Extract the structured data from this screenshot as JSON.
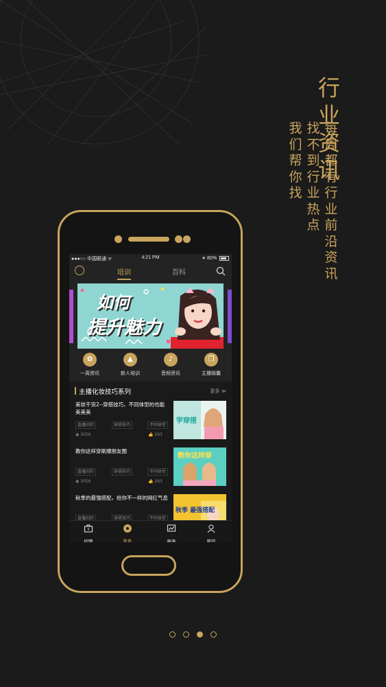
{
  "promo": {
    "headline": "行业资讯",
    "sub_col_1": "每周都有行业前沿资讯",
    "sub_col_2": "找不到行业热点",
    "sub_col_3": "我们帮你找"
  },
  "status_bar": {
    "carrier": "●●●○○ 中国联通 ᯤ",
    "time": "4:21 PM",
    "battery": "∗ 80%"
  },
  "nav": {
    "tab_active": "培训",
    "tab_inactive": "百科"
  },
  "banner": {
    "line1": "如何",
    "line2": "提升魅力"
  },
  "quick_links": [
    {
      "label": "一周资讯",
      "icon": "grid-icon",
      "glyph": "✿"
    },
    {
      "label": "新人培训",
      "icon": "hat-icon",
      "glyph": "▲"
    },
    {
      "label": "音频资讯",
      "icon": "music-icon",
      "glyph": "♪"
    },
    {
      "label": "主播锦囊",
      "icon": "book-icon",
      "glyph": "❐"
    }
  ],
  "section": {
    "title": "主播化妆技巧系列",
    "more": "更多 ≫"
  },
  "articles": [
    {
      "title": "美妆干货2--穿搭技巧，不同体型的也能美美美",
      "tags": [
        "直播间的",
        "穿搭技巧",
        "不同体型"
      ],
      "views": "3056",
      "likes": "263",
      "thumb_text": "学穿搭",
      "thumb_color": "#2fb8a8"
    },
    {
      "title": "教你这样穿刷爆朋友圈",
      "tags": [
        "直播间的",
        "穿搭技巧",
        "不同体型"
      ],
      "views": "3056",
      "likes": "263",
      "thumb_text": "教你这样穿",
      "thumb_color": "#4fc7bd"
    },
    {
      "title": "秋季的最强搭配，给你不一样的网红气息",
      "tags": [
        "直播间的",
        "穿搭技巧",
        "不同体型"
      ],
      "views": "",
      "likes": "",
      "thumb_text": "秋季 最强搭配",
      "thumb_color": "#f4c430"
    }
  ],
  "bottom_nav": [
    {
      "label": "招聘",
      "icon": "briefcase-icon"
    },
    {
      "label": "看看",
      "icon": "eye-icon"
    },
    {
      "label": "报表",
      "icon": "chart-icon"
    },
    {
      "label": "我的",
      "icon": "user-icon"
    }
  ],
  "colors": {
    "accent": "#c9a45c",
    "background": "#1b1b1b"
  },
  "pager": {
    "total": 4,
    "active_index": 2
  }
}
